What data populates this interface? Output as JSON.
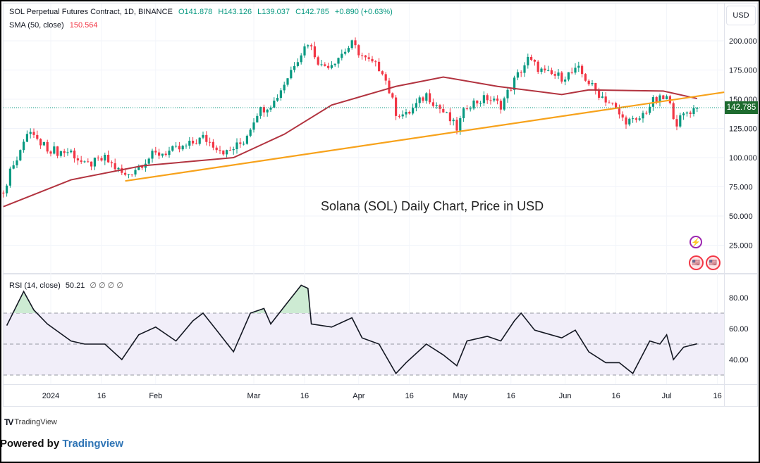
{
  "header": {
    "symbol": "SOL Perpetual Futures Contract, 1D, BINANCE",
    "open": "O141.878",
    "high": "H143.126",
    "low": "L139.037",
    "close": "C142.785",
    "change": "+0.890 (+0.63%)",
    "sma_label": "SMA (50, close)",
    "sma_value": "150.564"
  },
  "currency": "USD",
  "last_price": "142.785",
  "annotation": "Solana (SOL) Daily Chart, Price in USD",
  "rsi_header": {
    "label": "RSI (14, close)",
    "value": "50.21",
    "extra": "∅ ∅ ∅ ∅"
  },
  "footer": {
    "logo_text": "TradingView",
    "powered_prefix": "Powered by ",
    "powered_link": "Tradingview"
  },
  "colors": {
    "up": "#089981",
    "down": "#f23645",
    "sma": "#b2333f",
    "trendline": "#f7a21b",
    "rsi_line": "#131722",
    "rsi_band": "#f1eef9",
    "rsi_overbought_fill": "#cdebd3"
  },
  "chart_data": [
    {
      "type": "candlestick",
      "title": "SOL Perpetual Futures Contract, 1D, BINANCE",
      "ylabel": "USD",
      "ylim": [
        0,
        215
      ],
      "yticks": [
        200,
        175,
        150,
        125,
        100,
        75,
        50,
        25
      ],
      "ytick_labels": [
        "200.000",
        "175.000",
        "150.000",
        "125.000",
        "100.000",
        "75.000",
        "50.000",
        "25.000"
      ],
      "xticks": [
        {
          "date": "2024-01-01",
          "label": "2024"
        },
        {
          "date": "2024-01-16",
          "label": "16"
        },
        {
          "date": "2024-02-01",
          "label": "Feb"
        },
        {
          "date": "2024-03-01",
          "label": "Mar"
        },
        {
          "date": "2024-03-16",
          "label": "16"
        },
        {
          "date": "2024-04-01",
          "label": "Apr"
        },
        {
          "date": "2024-04-16",
          "label": "16"
        },
        {
          "date": "2024-05-01",
          "label": "May"
        },
        {
          "date": "2024-05-16",
          "label": "16"
        },
        {
          "date": "2024-06-01",
          "label": "Jun"
        },
        {
          "date": "2024-06-16",
          "label": "16"
        },
        {
          "date": "2024-07-01",
          "label": "Jul"
        },
        {
          "date": "2024-07-16",
          "label": "16"
        }
      ],
      "close_keypoints": [
        [
          "2023-12-18",
          72
        ],
        [
          "2023-12-21",
          96
        ],
        [
          "2023-12-26",
          123
        ],
        [
          "2023-12-29",
          111
        ],
        [
          "2024-01-03",
          105
        ],
        [
          "2024-01-07",
          105
        ],
        [
          "2024-01-11",
          93
        ],
        [
          "2024-01-17",
          99
        ],
        [
          "2024-01-23",
          84
        ],
        [
          "2024-01-31",
          102
        ],
        [
          "2024-02-09",
          108
        ],
        [
          "2024-02-15",
          117
        ],
        [
          "2024-02-22",
          104
        ],
        [
          "2024-02-27",
          114
        ],
        [
          "2024-03-02",
          139
        ],
        [
          "2024-03-07",
          148
        ],
        [
          "2024-03-11",
          169
        ],
        [
          "2024-03-13",
          181
        ],
        [
          "2024-03-17",
          199
        ],
        [
          "2024-03-21",
          178
        ],
        [
          "2024-03-24",
          181
        ],
        [
          "2024-03-30",
          197
        ],
        [
          "2024-04-03",
          184
        ],
        [
          "2024-04-08",
          175
        ],
        [
          "2024-04-12",
          139
        ],
        [
          "2024-04-15",
          136
        ],
        [
          "2024-04-21",
          154
        ],
        [
          "2024-04-26",
          139
        ],
        [
          "2024-04-30",
          125
        ],
        [
          "2024-05-03",
          145
        ],
        [
          "2024-05-09",
          151
        ],
        [
          "2024-05-13",
          145
        ],
        [
          "2024-05-17",
          166
        ],
        [
          "2024-05-21",
          184
        ],
        [
          "2024-05-26",
          172
        ],
        [
          "2024-05-31",
          169
        ],
        [
          "2024-06-05",
          175
        ],
        [
          "2024-06-10",
          157
        ],
        [
          "2024-06-15",
          145
        ],
        [
          "2024-06-18",
          133
        ],
        [
          "2024-06-22",
          130
        ],
        [
          "2024-06-27",
          148
        ],
        [
          "2024-07-01",
          151
        ],
        [
          "2024-07-04",
          130
        ],
        [
          "2024-07-07",
          139
        ],
        [
          "2024-07-10",
          142.785
        ]
      ],
      "last_candle": {
        "open": 141.878,
        "high": 143.126,
        "low": 139.037,
        "close": 142.785
      },
      "sma50": [
        [
          "2023-12-18",
          58
        ],
        [
          "2024-01-07",
          81
        ],
        [
          "2024-01-28",
          93
        ],
        [
          "2024-02-24",
          100
        ],
        [
          "2024-03-10",
          120
        ],
        [
          "2024-03-24",
          145
        ],
        [
          "2024-04-12",
          161
        ],
        [
          "2024-04-26",
          169
        ],
        [
          "2024-05-12",
          161
        ],
        [
          "2024-05-31",
          154
        ],
        [
          "2024-06-08",
          158
        ],
        [
          "2024-06-30",
          157
        ],
        [
          "2024-07-10",
          150.564
        ]
      ],
      "trendline": [
        [
          "2024-01-23",
          80
        ],
        [
          "2024-07-18",
          156
        ]
      ]
    },
    {
      "type": "line",
      "title": "RSI (14, close)",
      "ylim": [
        24,
        92
      ],
      "yticks": [
        80,
        60,
        40
      ],
      "ytick_labels": [
        "80.00",
        "60.00",
        "40.00"
      ],
      "bands": {
        "upper": 70,
        "middle": 50,
        "lower": 30
      },
      "values": [
        [
          "2023-12-19",
          62
        ],
        [
          "2023-12-24",
          84
        ],
        [
          "2023-12-27",
          72
        ],
        [
          "2023-12-31",
          63
        ],
        [
          "2024-01-07",
          52
        ],
        [
          "2024-01-11",
          50
        ],
        [
          "2024-01-17",
          50
        ],
        [
          "2024-01-22",
          40
        ],
        [
          "2024-01-27",
          56
        ],
        [
          "2024-02-01",
          61
        ],
        [
          "2024-02-07",
          52
        ],
        [
          "2024-02-12",
          65
        ],
        [
          "2024-02-15",
          70
        ],
        [
          "2024-02-19",
          59
        ],
        [
          "2024-02-24",
          45
        ],
        [
          "2024-02-29",
          70
        ],
        [
          "2024-03-04",
          73
        ],
        [
          "2024-03-06",
          63
        ],
        [
          "2024-03-11",
          77
        ],
        [
          "2024-03-15",
          88
        ],
        [
          "2024-03-17",
          86
        ],
        [
          "2024-03-18",
          63
        ],
        [
          "2024-03-24",
          61
        ],
        [
          "2024-03-30",
          67
        ],
        [
          "2024-04-02",
          54
        ],
        [
          "2024-04-07",
          50
        ],
        [
          "2024-04-12",
          31
        ],
        [
          "2024-04-15",
          38
        ],
        [
          "2024-04-21",
          50
        ],
        [
          "2024-04-26",
          43
        ],
        [
          "2024-04-30",
          36
        ],
        [
          "2024-05-03",
          52
        ],
        [
          "2024-05-09",
          55
        ],
        [
          "2024-05-13",
          52
        ],
        [
          "2024-05-17",
          65
        ],
        [
          "2024-05-19",
          70
        ],
        [
          "2024-05-23",
          59
        ],
        [
          "2024-05-31",
          54
        ],
        [
          "2024-06-04",
          59
        ],
        [
          "2024-06-08",
          45
        ],
        [
          "2024-06-13",
          38
        ],
        [
          "2024-06-17",
          38
        ],
        [
          "2024-06-21",
          31
        ],
        [
          "2024-06-26",
          52
        ],
        [
          "2024-06-29",
          50
        ],
        [
          "2024-07-01",
          56
        ],
        [
          "2024-07-03",
          40
        ],
        [
          "2024-07-06",
          48
        ],
        [
          "2024-07-10",
          50.21
        ]
      ]
    }
  ]
}
